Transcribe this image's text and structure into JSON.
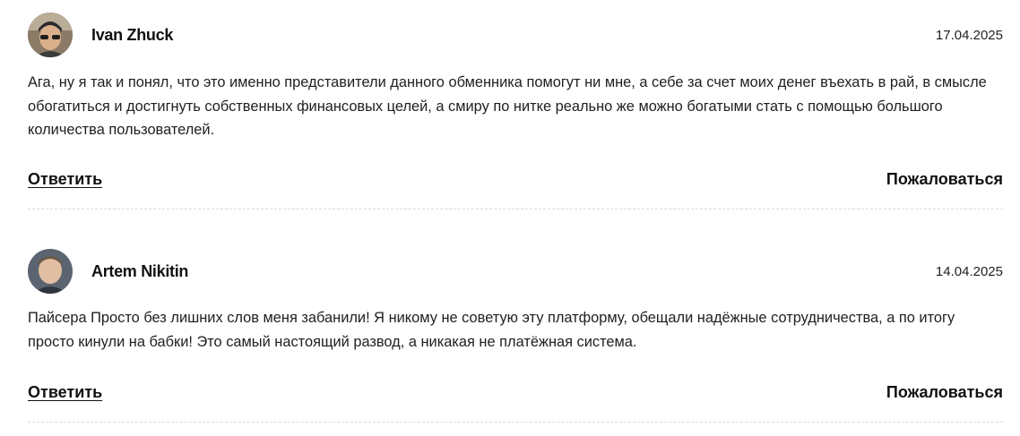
{
  "comments": [
    {
      "author": "Ivan Zhuck",
      "date": "17.04.2025",
      "text": "Ага, ну я так и понял, что это именно представители данного обменника помогут ни мне, а себе за счет моих денег въехать в рай, в смысле обогатиться и достигнуть собственных финансовых целей, а смиру по нитке реально же можно богатыми стать с помощью большого количества пользователей.",
      "reply_label": "Ответить",
      "report_label": "Пожаловаться",
      "avatar_icon": "avatar-photo"
    },
    {
      "author": "Artem Nikitin",
      "date": "14.04.2025",
      "text": "Пайсера Просто без лишних слов меня забанили! Я никому не советую эту платформу, обещали надёжные сотрудничества, а по итогу просто кинули на бабки! Это самый настоящий развод, а никакая не платёжная система.",
      "reply_label": "Ответить",
      "report_label": "Пожаловаться",
      "avatar_icon": "avatar-photo"
    }
  ]
}
